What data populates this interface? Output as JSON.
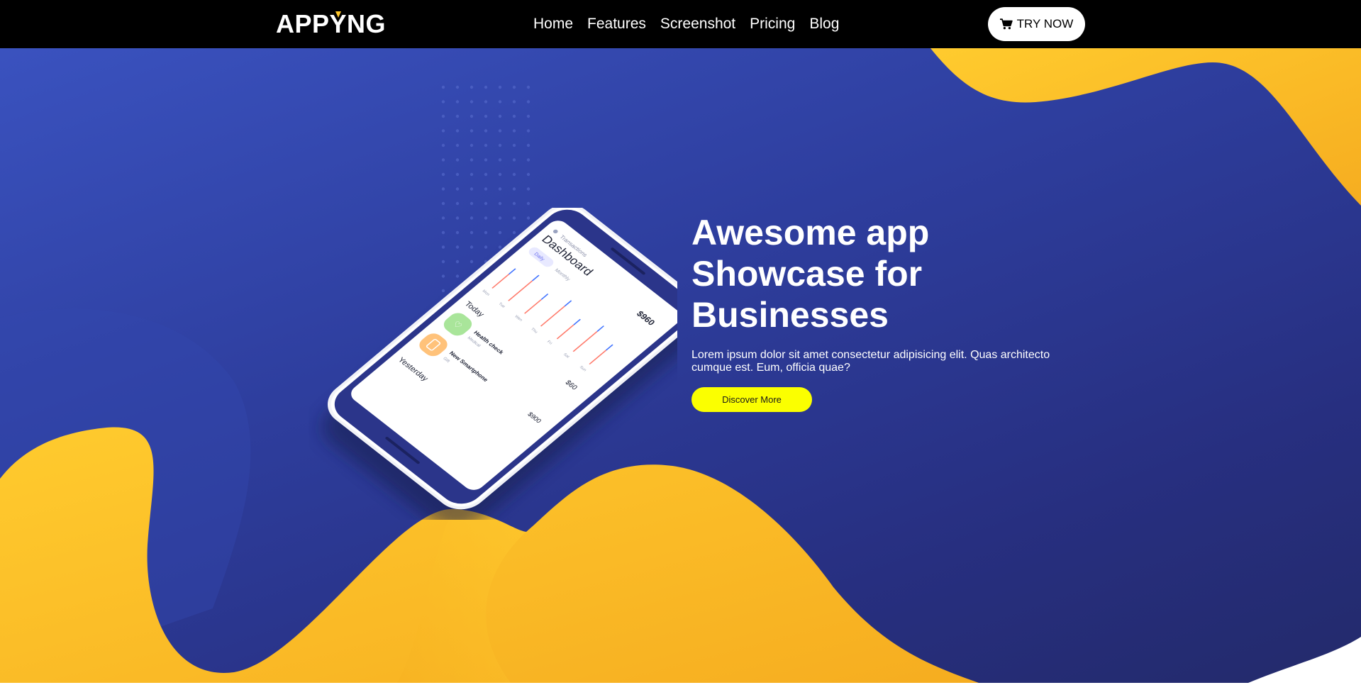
{
  "nav": {
    "logo_part1": "APP",
    "logo_accent_letter": "Y",
    "logo_part2": "NG",
    "links": [
      "Home",
      "Features",
      "Screenshot",
      "Pricing",
      "Blog"
    ],
    "cta_label": "TRY NOW",
    "cta_icon": "cart-icon"
  },
  "hero": {
    "title_lines": [
      "Awesome app",
      "Showcase for",
      "Businesses"
    ],
    "description": "Lorem ipsum dolor sit amet consectetur adipisicing elit. Quas architecto cumque est. Eum, officia quae?",
    "button_label": "Discover More"
  },
  "phone_screen": {
    "subtitle": "Transactions",
    "title": "Dashboard",
    "total": "$960",
    "tabs": [
      "Daily",
      "Monthly"
    ],
    "days": [
      "Mon",
      "Tue",
      "Wen",
      "Thu",
      "Fri",
      "Sat",
      "Sun"
    ],
    "today_label": "Today",
    "today_total": "$60",
    "items": [
      {
        "name": "Health check",
        "category": "Medical",
        "amount": ""
      },
      {
        "name": "New Smartphone",
        "category": "Gift",
        "amount": "$900"
      }
    ],
    "yesterday_label": "Yesterday"
  },
  "colors": {
    "navbar": "#000000",
    "hero_blue": "#2e3e9e",
    "wave_yellow": "#ffc629",
    "discover_button": "#fbff00",
    "cta_button": "#ffffff"
  }
}
